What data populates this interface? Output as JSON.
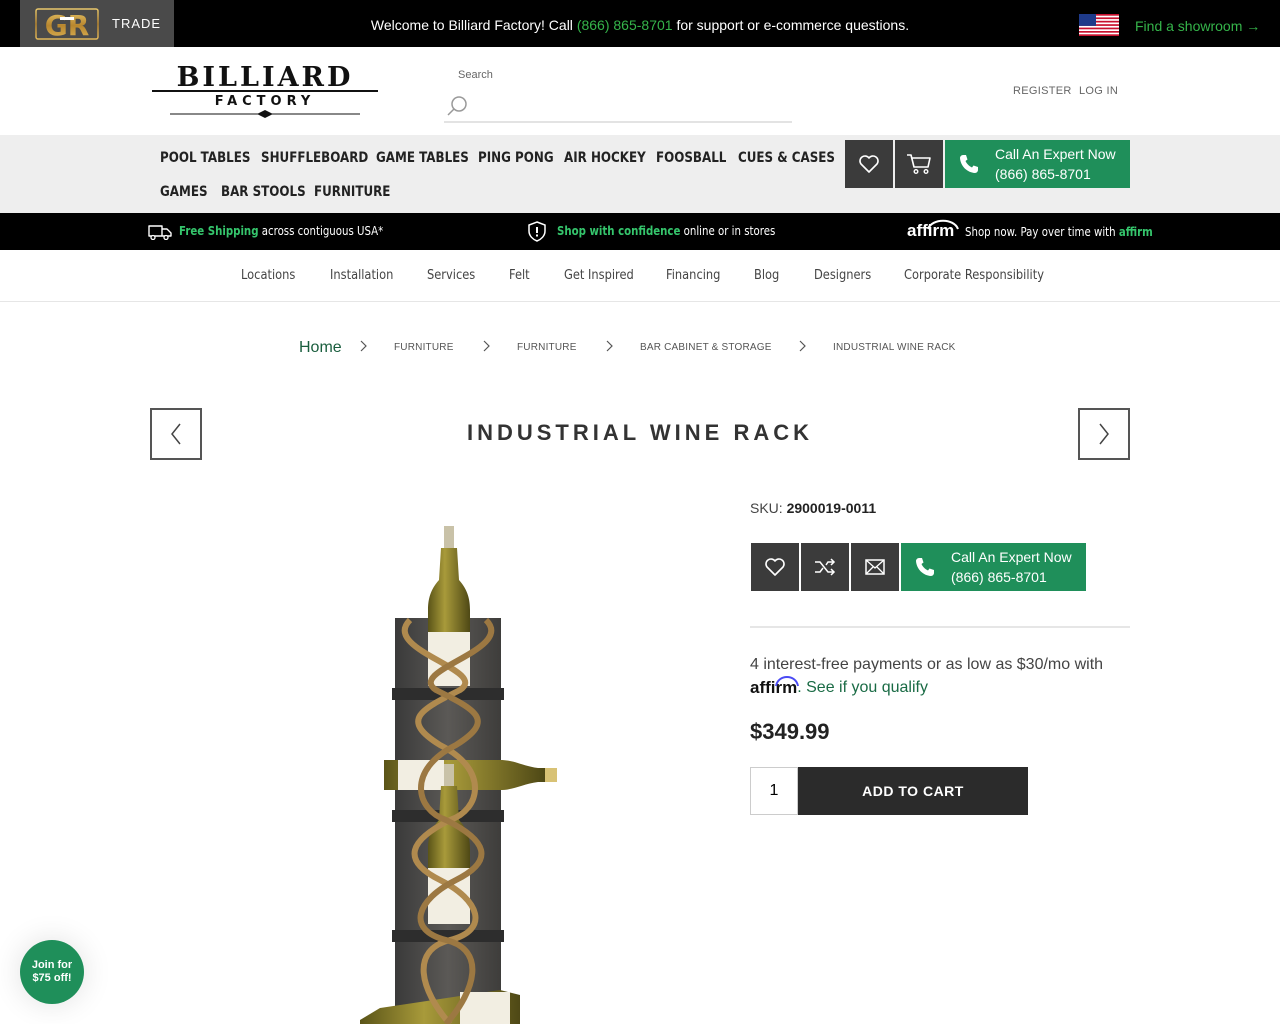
{
  "topbar": {
    "trade_logo_text": "GR",
    "trade_label": "TRADE",
    "welcome_prefix": "Welcome to Billiard Factory! Call ",
    "welcome_phone": "(866) 865-8701",
    "welcome_suffix": " for support or e-commerce questions.",
    "flag_icon": "us-flag-icon",
    "showroom_link": "Find a showroom →"
  },
  "header": {
    "logo_line1": "BILLIARD",
    "logo_line2": "FACTORY",
    "search_label": "Search",
    "search_placeholder": "",
    "register": "REGISTER",
    "login": "LOG IN"
  },
  "main_nav": {
    "items": [
      "POOL TABLES",
      "SHUFFLEBOARD",
      "GAME TABLES",
      "PING PONG",
      "AIR HOCKEY",
      "FOOSBALL",
      "CUES & CASES",
      "GAMES",
      "BAR STOOLS",
      "FURNITURE"
    ],
    "wishlist_icon": "heart-icon",
    "cart_icon": "cart-icon",
    "call_line1": "Call An Expert Now",
    "call_line2": "(866) 865-8701"
  },
  "promo": {
    "shipping_highlight": "Free Shipping",
    "shipping_rest": " across contiguous USA*",
    "confidence_highlight": "Shop with confidence",
    "confidence_rest": " online or in stores",
    "affirm_logo": "affirm",
    "affirm_text": "Shop now. Pay over time with ",
    "affirm_highlight": "affirm"
  },
  "sub_nav": {
    "items": [
      "Locations",
      "Installation",
      "Services",
      "Felt",
      "Get Inspired",
      "Financing",
      "Blog",
      "Designers",
      "Corporate Responsibility"
    ]
  },
  "breadcrumb": {
    "home": "Home",
    "items": [
      "FURNITURE",
      "FURNITURE",
      "BAR CABINET & STORAGE",
      "INDUSTRIAL WINE RACK"
    ]
  },
  "product": {
    "title": "INDUSTRIAL WINE RACK",
    "sku_label": "SKU:",
    "sku": "2900019-0011",
    "call_line1": "Call An Expert Now",
    "call_line2": "(866) 865-8701",
    "affirm_line1": "4 interest-free payments or as low as $30/mo with",
    "affirm_logo": "affirm",
    "affirm_qualify": ". See if you qualify",
    "price": "$349.99",
    "quantity": "1",
    "add_to_cart": "ADD TO CART"
  },
  "join_badge": {
    "line1": "Join for",
    "line2": "$75 off!"
  }
}
